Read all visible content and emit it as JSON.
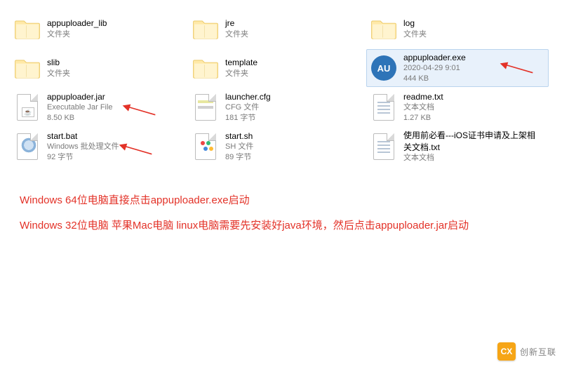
{
  "files": [
    {
      "name": "appuploader_lib",
      "type": "文件夹",
      "size": ""
    },
    {
      "name": "jre",
      "type": "文件夹",
      "size": ""
    },
    {
      "name": "log",
      "type": "文件夹",
      "size": ""
    },
    {
      "name": "slib",
      "type": "文件夹",
      "size": ""
    },
    {
      "name": "template",
      "type": "文件夹",
      "size": ""
    },
    {
      "name": "appuploader.exe",
      "type": "2020-04-29 9:01",
      "size": "444 KB"
    },
    {
      "name": "appuploader.jar",
      "type": "Executable Jar File",
      "size": "8.50 KB"
    },
    {
      "name": "launcher.cfg",
      "type": "CFG 文件",
      "size": "181 字节"
    },
    {
      "name": "readme.txt",
      "type": "文本文档",
      "size": "1.27 KB"
    },
    {
      "name": "start.bat",
      "type": "Windows 批处理文件",
      "size": "92 字节"
    },
    {
      "name": "start.sh",
      "type": "SH 文件",
      "size": "89 字节"
    },
    {
      "name": "使用前必看---iOS证书申请及上架相关文档.txt",
      "type": "文本文档",
      "size": ""
    }
  ],
  "selected_index": 5,
  "au_badge": "AU",
  "notes": {
    "line1": "Windows 64位电脑直接点击appuploader.exe启动",
    "line2": "Windows 32位电脑 苹果Mac电脑 linux电脑需要先安装好java环境，然后点击appuploader.jar启动"
  },
  "watermark": {
    "badge": "CX",
    "text": "创新互联"
  },
  "arrows": {
    "color": "#e33228"
  }
}
